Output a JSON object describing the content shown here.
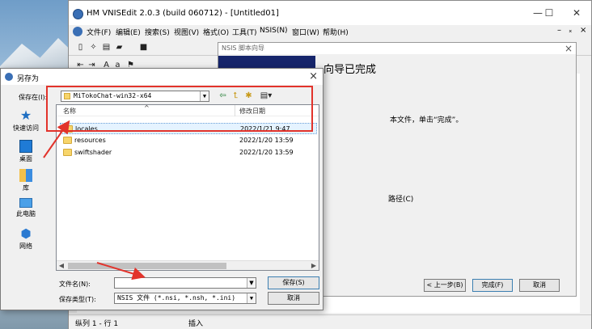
{
  "app": {
    "title": "HM VNISEdit 2.0.3 (build 060712) - [Untitled01]",
    "window_buttons": [
      "—",
      "☐",
      "✕"
    ],
    "menu": [
      "文件(F)",
      "编辑(E)",
      "搜索(S)",
      "视图(V)",
      "格式(O)",
      "工具(T)",
      "NSIS(N)",
      "窗口(W)",
      "帮助(H)"
    ],
    "menu_right": [
      "–",
      "ₓ",
      "×"
    ],
    "status": {
      "position": "纵列 1 - 行 1",
      "mode": "插入"
    }
  },
  "wizard": {
    "title": "NSIS 脚本向导",
    "heading": "向导已完成",
    "text1": "本文件，单击“完成”。",
    "text2": "路径(C)",
    "buttons": {
      "back": "< 上一步(B)",
      "finish": "完成(F)",
      "cancel": "取消"
    }
  },
  "dialog": {
    "title": "另存为",
    "save_in_label": "保存在(I):",
    "save_in_value": "MiTokoChat-win32-x64",
    "places": [
      "快速访问",
      "桌面",
      "库",
      "此电脑",
      "网络"
    ],
    "columns": {
      "name": "名称",
      "modified": "修改日期"
    },
    "files": [
      {
        "name": "locales",
        "modified": "2022/1/21 9:47"
      },
      {
        "name": "resources",
        "modified": "2022/1/20 13:59"
      },
      {
        "name": "swiftshader",
        "modified": "2022/1/20 13:59"
      }
    ],
    "filename_label": "文件名(N):",
    "filename_value": "",
    "filetype_label": "保存类型(T):",
    "filetype_value": "NSIS 文件 (*.nsi, *.nsh, *.ini)",
    "save_button": "保存(S)",
    "cancel_button": "取消"
  },
  "colors": {
    "annotation": "#e2332b",
    "dialog_bg": "#f0f0f0",
    "selection": "#e5f3ff"
  }
}
